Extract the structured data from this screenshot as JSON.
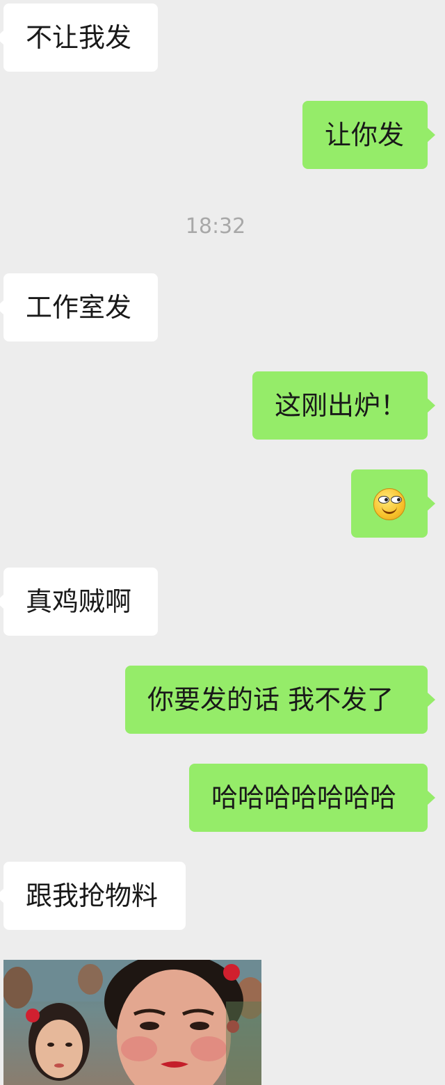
{
  "messages": [
    {
      "side": "left",
      "text": "不让我发"
    },
    {
      "side": "right",
      "text": "让你发"
    },
    {
      "side": "left",
      "text": "工作室发"
    },
    {
      "side": "right",
      "text": "这刚出炉！"
    },
    {
      "side": "right",
      "emoji": "smirk-face-emoji"
    },
    {
      "side": "left",
      "text": "真鸡贼啊"
    },
    {
      "side": "right",
      "text": "你要发的话 我不发了"
    },
    {
      "side": "right",
      "text": "哈哈哈哈哈哈哈"
    },
    {
      "side": "left",
      "text": "跟我抢物料"
    },
    {
      "side": "left",
      "image": "film-still-photo"
    }
  ],
  "timestamp": "18:32",
  "colors": {
    "background": "#ededed",
    "left_bubble": "#ffffff",
    "right_bubble": "#95ec69",
    "timestamp": "#a8a8a8"
  }
}
